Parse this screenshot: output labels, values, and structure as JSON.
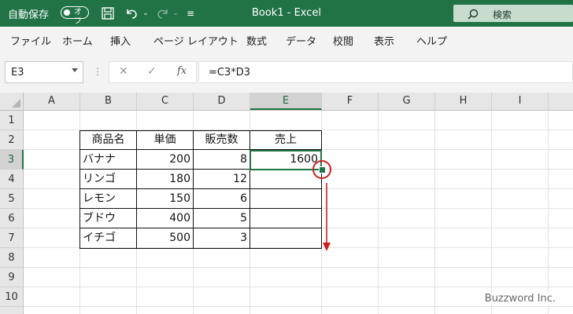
{
  "titlebar": {
    "autosave_label": "自動保存",
    "toggle_label": "オフ",
    "title": "Book1  -  Excel",
    "search_placeholder": "検索",
    "icons": [
      "save-icon",
      "undo-icon",
      "redo-icon",
      "customize-qat-icon",
      "search-icon"
    ]
  },
  "menu": {
    "items": [
      "ファイル",
      "ホーム",
      "挿入",
      "ページ レイアウト",
      "数式",
      "データ",
      "校閲",
      "表示",
      "ヘルプ"
    ]
  },
  "formula_bar": {
    "name_box": "E3",
    "fx_label": "fx",
    "formula": "=C3*D3"
  },
  "sheet": {
    "columns": [
      "A",
      "B",
      "C",
      "D",
      "E",
      "F",
      "G",
      "H",
      "I"
    ],
    "rows": [
      "1",
      "2",
      "3",
      "4",
      "5",
      "6",
      "7",
      "8",
      "9",
      "10"
    ],
    "selected_column": "E",
    "selected_row": "3",
    "table": {
      "headers": [
        "商品名",
        "単価",
        "販売数",
        "売上"
      ],
      "rows": [
        [
          "バナナ",
          "200",
          "8",
          "1600"
        ],
        [
          "リンゴ",
          "180",
          "12",
          ""
        ],
        [
          "レモン",
          "150",
          "6",
          ""
        ],
        [
          "ブドウ",
          "400",
          "5",
          ""
        ],
        [
          "イチゴ",
          "500",
          "3",
          ""
        ]
      ]
    }
  },
  "annotation_color": "#cc1f1f",
  "accent_color": "#217346",
  "watermark": "Buzzword Inc."
}
